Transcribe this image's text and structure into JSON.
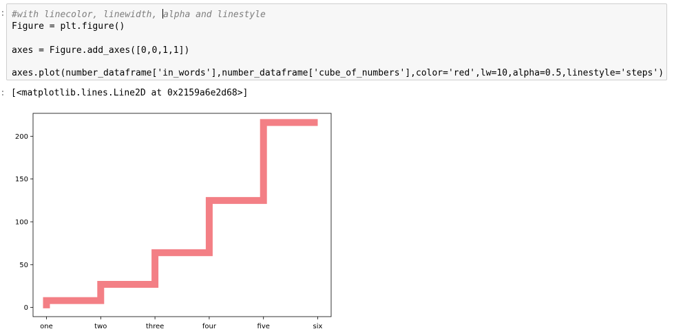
{
  "notebook": {
    "input_prompt": ":",
    "output_prompt": ":",
    "code_lines": [
      {
        "kind": "comment",
        "before_caret": "#with linecolor, linewidth, ",
        "after_caret": "alpha and linestyle"
      },
      {
        "kind": "code",
        "text": "Figure = plt.figure()"
      },
      {
        "kind": "blank",
        "text": ""
      },
      {
        "kind": "code",
        "text": "axes = Figure.add_axes([0,0,1,1])"
      },
      {
        "kind": "blank",
        "text": ""
      },
      {
        "kind": "code",
        "text": "axes.plot(number_dataframe['in_words'],number_dataframe['cube_of_numbers'],color='red',lw=10,alpha=0.5,linestyle='steps')"
      }
    ],
    "output_text": "[<matplotlib.lines.Line2D at 0x2159a6e2d68>]"
  },
  "chart_data": {
    "type": "line",
    "linestyle": "steps",
    "color": "#f08080",
    "categories": [
      "one",
      "two",
      "three",
      "four",
      "five",
      "six"
    ],
    "values": [
      1,
      8,
      27,
      64,
      125,
      216
    ],
    "yticks": [
      0,
      50,
      100,
      150,
      200
    ],
    "ylim": [
      -10.75,
      226.75
    ],
    "grid": false
  }
}
